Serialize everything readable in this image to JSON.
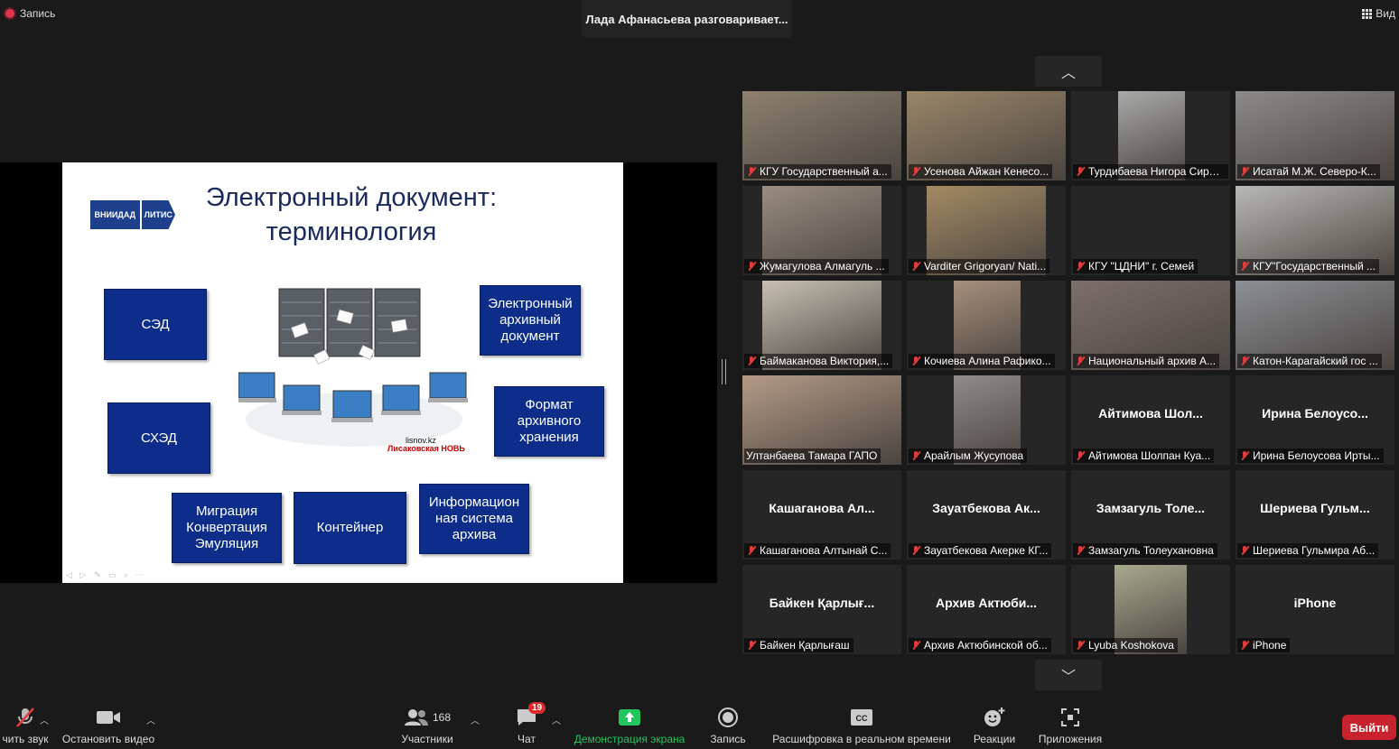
{
  "top": {
    "recording_label": "Запись",
    "speaker_banner": "Лада Афанасьева разговаривает...",
    "view_label": "Вид"
  },
  "slide": {
    "logo_left": "ВНИИДАД",
    "logo_right": "ЛИТИС",
    "title": "Электронный документ: терминология",
    "boxes": {
      "sed": "СЭД",
      "skhed": "СХЭД",
      "migration": "Миграция Конвертация Эмуляция",
      "container": "Контейнер",
      "info_system": "Информацион ная система архива",
      "e_archive_doc": "Электронный архивный документ",
      "format": "Формат архивного хранения"
    },
    "illus_caption_site": "lisnov.kz",
    "illus_caption_paper": "Лисаковская НОВЬ"
  },
  "gallery": {
    "tiles": [
      {
        "label": "КГУ Государственный а...",
        "big": "",
        "video": "#8d8070"
      },
      {
        "label": "Усенова Айжан Кенесо...",
        "big": "",
        "video": "#9a8668"
      },
      {
        "label": "Турдибаева Нигора Сирда...",
        "big": "",
        "video": "#a9aaa8"
      },
      {
        "label": "Исатай М.Ж. Северо-К...",
        "big": "",
        "video": "#8c8a88"
      },
      {
        "label": "Жумагулова Алмагуль ...",
        "big": "",
        "video": "#9a8d80"
      },
      {
        "label": "Varditer Grigoryan/ Nati...",
        "big": "",
        "video": "#a48a63"
      },
      {
        "label": "КГУ \"ЦДНИ\" г. Семей",
        "big": "",
        "video": ""
      },
      {
        "label": "КГУ\"Государственный ...",
        "big": "",
        "video": "#b8b8b4"
      },
      {
        "label": "Баймаканова Виктория,...",
        "big": "",
        "video": "#c7c0b2"
      },
      {
        "label": "Кочиева Алина Рафико...",
        "big": "",
        "video": "#a88f7c"
      },
      {
        "label": "Национальный архив А...",
        "big": "",
        "video": "#7d6f6b"
      },
      {
        "label": "Катон-Карагайский гос ...",
        "big": "",
        "video": "#8c8f94"
      },
      {
        "label": "Ултанбаева Тамара ГАПО",
        "big": "",
        "video": "#b59a86"
      },
      {
        "label": "Арайлым Жусупова",
        "big": "",
        "video": "#8f8c8a"
      },
      {
        "label": "Айтимова Шолпан Куа...",
        "big": "Айтимова Шол...",
        "video": ""
      },
      {
        "label": "Ирина Белоусова Ирты...",
        "big": "Ирина Белоусо...",
        "video": ""
      },
      {
        "label": "Кашаганова Алтынай С...",
        "big": "Кашаганова Ал...",
        "video": ""
      },
      {
        "label": "Зауатбекова Акерке КГ...",
        "big": "Зауатбекова Ак...",
        "video": ""
      },
      {
        "label": "Замзагуль Толеухановна",
        "big": "Замзагуль Толе...",
        "video": ""
      },
      {
        "label": "Шериева Гульмира Аб...",
        "big": "Шериева Гульм...",
        "video": ""
      },
      {
        "label": "Байкен Қарлығаш",
        "big": "Байкен Қарлығ...",
        "video": ""
      },
      {
        "label": "Архив Актюбинской об...",
        "big": "Архив Актюби...",
        "video": ""
      },
      {
        "label": "Lyuba Koshokova",
        "big": "",
        "video": "#a7a98e"
      },
      {
        "label": "iPhone",
        "big": "iPhone",
        "video": ""
      }
    ]
  },
  "toolbar": {
    "audio": "чить звук",
    "video": "Остановить видео",
    "participants": "Участники",
    "participants_count": "168",
    "chat": "Чат",
    "chat_badge": "19",
    "share": "Демонстрация экрана",
    "record": "Запись",
    "captions": "Расшифровка в реальном времени",
    "reactions": "Реакции",
    "apps": "Приложения",
    "leave": "Выйти"
  },
  "colors": {
    "slide_box": "#0c2d8a",
    "share_green": "#23c55e",
    "leave_red": "#c8232c",
    "mic_red": "#e23b3b"
  }
}
